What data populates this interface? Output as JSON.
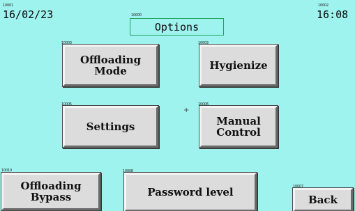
{
  "header": {
    "date": "16/02/23",
    "time": "16:08",
    "title": "Options",
    "date_id": "10001",
    "time_id": "10002",
    "title_id": "10000"
  },
  "buttons": {
    "offloading_mode": {
      "label": "Offloading\nMode",
      "id": "10003"
    },
    "hygienize": {
      "label": "Hygienize",
      "id": "10003"
    },
    "settings": {
      "label": "Settings",
      "id": "10005"
    },
    "manual_control": {
      "label": "Manual\nControl",
      "id": "10006"
    },
    "offloading_bypass": {
      "label": "Offloading\nBypass",
      "id": "10010"
    },
    "password_level": {
      "label": "Password level",
      "id": "10008"
    },
    "back": {
      "label": "Back",
      "id": "10007"
    }
  },
  "marker": "+",
  "colors": {
    "background": "#9ff3ef",
    "button": "#dcdcdc",
    "title_border": "#1ea05a"
  }
}
